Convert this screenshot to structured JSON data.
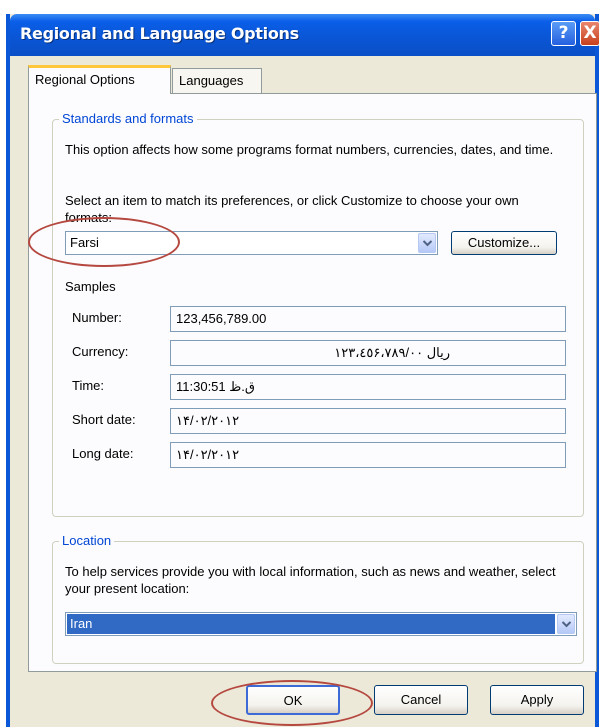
{
  "window": {
    "title": "Regional and Language Options",
    "help_glyph": "?",
    "close_glyph": "X"
  },
  "tabs": [
    {
      "label": "Regional Options",
      "active": true
    },
    {
      "label": "Languages",
      "active": false
    }
  ],
  "standards": {
    "legend": "Standards and formats",
    "description": "This option affects how some programs format numbers, currencies, dates, and time.",
    "instruction": "Select an item to match its preferences, or click Customize to choose your own formats:",
    "selected_format": "Farsi",
    "customize_label": "Customize...",
    "samples_label": "Samples",
    "samples": [
      {
        "label": "Number:",
        "value": "123,456,789.00"
      },
      {
        "label": "Currency:",
        "value": "ريال ١٢٣،٤٥۶،٧٨٩/٠٠"
      },
      {
        "label": "Time:",
        "value": "ق.ظ 11:30:51"
      },
      {
        "label": "Short date:",
        "value": "١۴/٠٢/٢٠١٢"
      },
      {
        "label": "Long date:",
        "value": "١۴/٠٢/٢٠١٢"
      }
    ]
  },
  "location": {
    "legend": "Location",
    "description": "To help services provide you with local information, such as news and weather, select your present location:",
    "selected": "Iran"
  },
  "footer": {
    "ok_label": "OK",
    "cancel_label": "Cancel",
    "apply_label": "Apply"
  },
  "colors": {
    "titlebar": "#0a56d6",
    "dialog_bg": "#ece9d8",
    "legend_text": "#0046d5",
    "selection": "#316ac5",
    "annotation": "#b5483f"
  },
  "icons": [
    "help-icon",
    "close-icon",
    "chevron-down-icon"
  ]
}
